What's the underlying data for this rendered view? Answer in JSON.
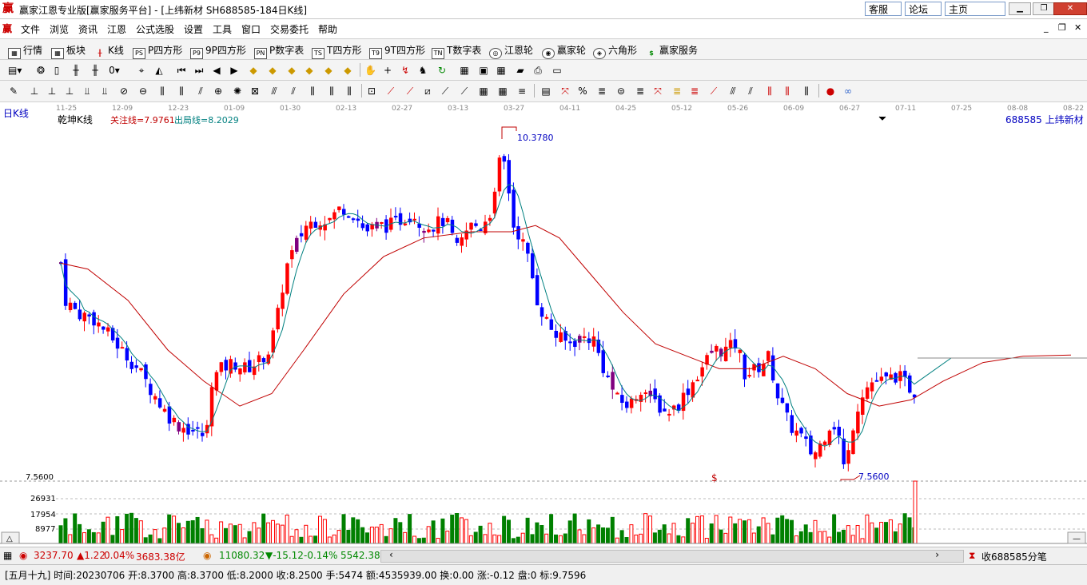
{
  "window": {
    "title": "赢家江恩专业版[赢家服务平台] - [上纬新材  SH688585-184日K线]",
    "app_icon": "赢",
    "top_buttons": [
      "客服",
      "论坛",
      "主页"
    ],
    "controls": [
      "minimize-icon",
      "restore-icon",
      "close-icon"
    ]
  },
  "menu": [
    "文件",
    "浏览",
    "资讯",
    "江恩",
    "公式选股",
    "设置",
    "工具",
    "窗口",
    "交易委托",
    "帮助"
  ],
  "toolbar1": [
    "行情",
    "板块",
    "K线",
    "P四方形",
    "9P四方形",
    "P数字表",
    "T四方形",
    "9T四方形",
    "T数字表",
    "江恩轮",
    "赢家轮",
    "六角形",
    "赢家服务"
  ],
  "chart": {
    "period_label": "日K线",
    "indicator_name": "乾坤K线",
    "attention_line": "关注线=7.9761",
    "exit_line": "出局线=8.2029",
    "stock_label": "688585  上纬新材",
    "high_label": "10.3780",
    "low_label": "7.5600",
    "dollar_mark": "$",
    "date_ticks": [
      "11-25",
      "12-09",
      "12-23",
      "01-09",
      "01-30",
      "02-13",
      "02-27",
      "03-13",
      "03-27",
      "04-11",
      "04-25",
      "05-12",
      "05-26",
      "06-09",
      "06-27",
      "07-11",
      "07-25",
      "08-08",
      "08-22"
    ],
    "volume_axis": {
      "top_label": "7.5600",
      "labels": [
        "26931",
        "17954",
        "8977"
      ]
    },
    "colors": {
      "up": "#ff0000",
      "down": "#0000ff",
      "special": "#800080",
      "ma_fast": "#008080",
      "ma_slow": "#c00000",
      "vol_up": "#ff0000",
      "vol_down": "#008000"
    }
  },
  "status1": {
    "sh_index": "3237.70",
    "sh_change": "▲1.22",
    "sh_pct": "0.04%",
    "sh_amount": "3683.38亿",
    "sz_index": "11080.32",
    "sz_change": "▼-15.12",
    "sz_pct": "-0.14%",
    "sz_amount": "5542.38",
    "right_label": "收688585分笔"
  },
  "status2": "[五月十九] 时间:20230706 开:8.3700 高:8.3700 低:8.2000 收:8.2500 手:5474 额:4535939.00 换:0.00 涨:-0.12 盘:0 标:9.7596"
}
